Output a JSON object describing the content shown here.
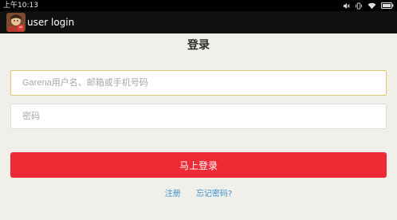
{
  "status_bar": {
    "time": "上午10:13",
    "icons": [
      "mute-icon",
      "vibrate-icon",
      "wifi-icon",
      "battery-icon"
    ]
  },
  "app_bar": {
    "title": "user login",
    "icon": "app-icon"
  },
  "login": {
    "heading": "登录",
    "username_placeholder": "Garena用户名、邮箱或手机号码",
    "password_placeholder": "密码",
    "submit_label": "马上登录",
    "register_link": "注册",
    "forgot_link": "忘记密码?"
  },
  "colors": {
    "accent": "#ee2b34",
    "link": "#3a93d4",
    "focus_border": "#e7c46a",
    "background": "#f1efe9"
  }
}
